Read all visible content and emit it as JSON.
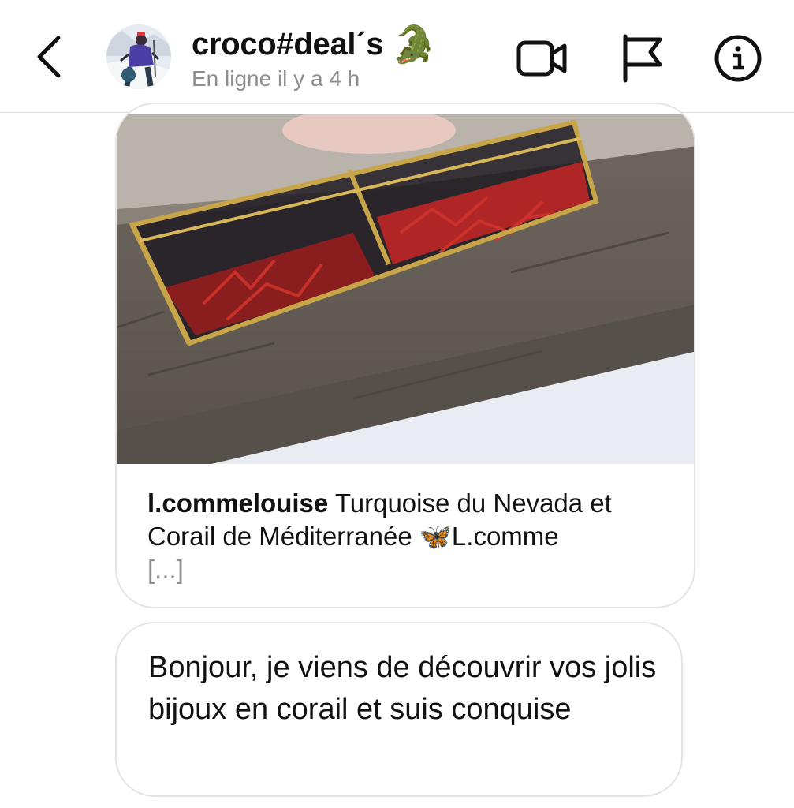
{
  "header": {
    "back_icon": "chevron-left-icon",
    "contact_name": "croco#deal´s",
    "name_emoji": "🐊",
    "status": "En ligne il y a 4 h",
    "icons": [
      "video-camera-icon",
      "flag-icon",
      "info-icon"
    ]
  },
  "shared_post": {
    "username": "l.commelouise",
    "caption": "Turquoise du Nevada et Corail de Méditerranée 🦋L.comme",
    "more": "[...]"
  },
  "message": {
    "text": "Bonjour, je viens de découvrir vos jolis bijoux en corail et suis conquise"
  }
}
